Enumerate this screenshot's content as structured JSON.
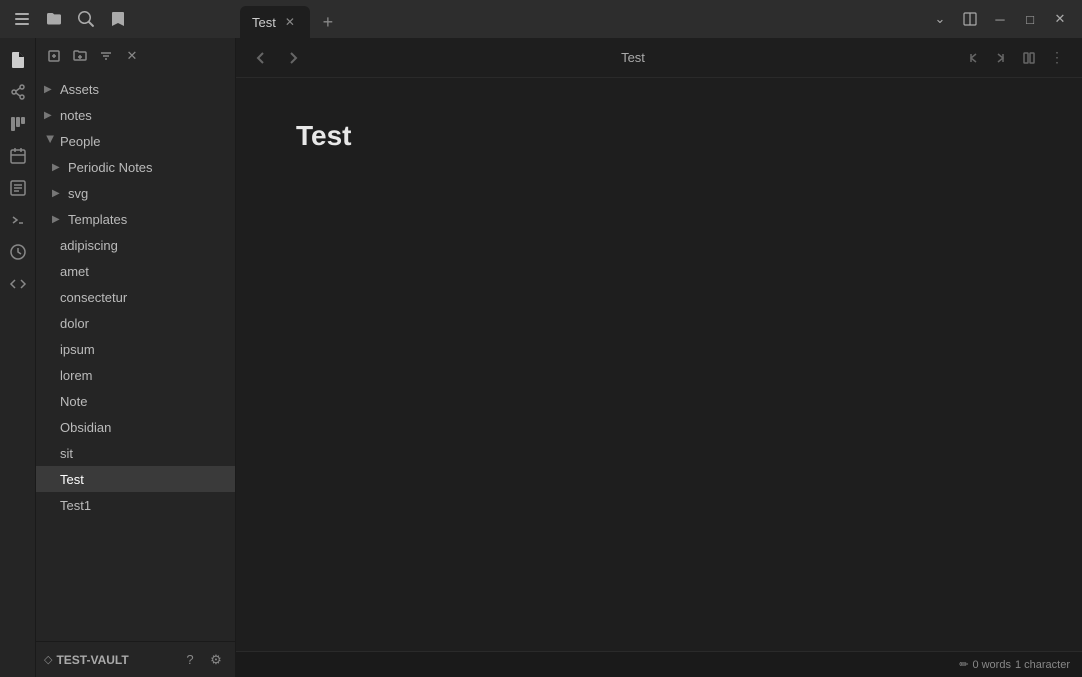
{
  "titlebar": {
    "icons": {
      "sidebar": "☰",
      "folder": "📁",
      "search": "🔍",
      "bookmark": "🔖"
    },
    "tab": {
      "label": "Test",
      "close": "✕"
    },
    "tab_add": "+",
    "window_controls": {
      "dropdown": "⌄",
      "split": "⧉",
      "minimize": "─",
      "maximize": "□",
      "close": "✕"
    }
  },
  "activity_bar": {
    "icons": [
      "📂",
      "🔗",
      "⊞",
      "📅",
      "📄",
      ">_",
      "🕐",
      "</>"
    ]
  },
  "sidebar": {
    "toolbar": {
      "new_note": "✏",
      "new_folder": "📁",
      "sort": "↕",
      "collapse": "✕"
    },
    "tree": [
      {
        "id": "assets",
        "label": "Assets",
        "expanded": false,
        "indent": 0
      },
      {
        "id": "notes",
        "label": "notes",
        "expanded": false,
        "indent": 0
      },
      {
        "id": "people",
        "label": "People",
        "expanded": true,
        "indent": 0
      },
      {
        "id": "periodic-notes",
        "label": "Periodic Notes",
        "expanded": false,
        "indent": 0
      },
      {
        "id": "svg",
        "label": "svg",
        "expanded": false,
        "indent": 0
      },
      {
        "id": "templates",
        "label": "Templates",
        "expanded": false,
        "indent": 0
      },
      {
        "id": "adipiscing",
        "label": "adipiscing",
        "expanded": false,
        "indent": 1,
        "isFile": true
      },
      {
        "id": "amet",
        "label": "amet",
        "expanded": false,
        "indent": 1,
        "isFile": true
      },
      {
        "id": "consectetur",
        "label": "consectetur",
        "expanded": false,
        "indent": 1,
        "isFile": true
      },
      {
        "id": "dolor",
        "label": "dolor",
        "expanded": false,
        "indent": 1,
        "isFile": true
      },
      {
        "id": "ipsum",
        "label": "ipsum",
        "expanded": false,
        "indent": 1,
        "isFile": true
      },
      {
        "id": "lorem",
        "label": "lorem",
        "expanded": false,
        "indent": 1,
        "isFile": true
      },
      {
        "id": "note",
        "label": "Note",
        "expanded": false,
        "indent": 1,
        "isFile": true
      },
      {
        "id": "obsidian",
        "label": "Obsidian",
        "expanded": false,
        "indent": 1,
        "isFile": true
      },
      {
        "id": "sit",
        "label": "sit",
        "expanded": false,
        "indent": 1,
        "isFile": true
      },
      {
        "id": "test",
        "label": "Test",
        "expanded": false,
        "indent": 1,
        "isFile": true,
        "active": true
      },
      {
        "id": "test1",
        "label": "Test1",
        "expanded": false,
        "indent": 1,
        "isFile": true
      }
    ],
    "vault": {
      "icon": "◇",
      "name": "TEST-VAULT",
      "help": "?",
      "settings": "⚙"
    }
  },
  "editor": {
    "nav_back": "‹",
    "nav_forward": "›",
    "title": "Test",
    "content_title": "Test",
    "header_buttons": {
      "back_stack": "◁",
      "forward_stack": "▷",
      "reading_view": "⊟",
      "more": "⋮"
    }
  },
  "statusbar": {
    "edit_icon": "✏",
    "word_count": "0 words",
    "char_count": "1 character"
  }
}
